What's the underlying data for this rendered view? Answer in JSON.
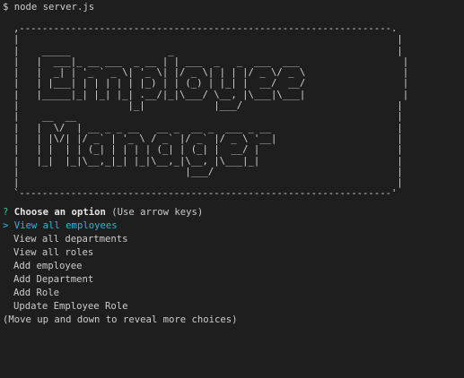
{
  "terminal": {
    "prompt_symbol": "$",
    "command": "node server.js"
  },
  "banner": {
    "ascii_art": ",-----------------------------------------------------------------.\n|                                                                  |\n|    _____                 _                                       |\n|   |  ___|_ __ ___  _ __ | | ___  _   _  ___  ___                  |\n|   |  _| | '_ ` _ \\| '_ \\| |/ _ \\| | | |/ _ \\/ _ \\                 |\n|   | |___| | | | | | |_) | | (_) | |_| |  __/  __/                 |\n|   |_____|_| |_| |_| .__/|_|\\___/ \\__, |\\___|\\___|                 |\n|                   |_|            |___/                           |\n|    __  __                                                        |\n|   |  \\/  | __ _ _ __   __ _  __ _  ___ _ __                      |\n|   | |\\/| |/ _` | '_ \\ / _` |/ _` |/ _ \\ '__|                     |\n|   | |  | | (_| | | | | (_| | (_| |  __/ |                        |\n|   |_|  |_|\\__,_|_| |_|\\__,_|\\__, |\\___|_|                        |\n|                             |___/                                |\n|                                                                  |\n`-----------------------------------------------------------------'"
  },
  "prompt": {
    "marker": "?",
    "question": "Choose an option",
    "hint": "(Use arrow keys)",
    "pointer": ">",
    "selected": "View all employees",
    "choices": [
      "View all departments",
      "View all roles",
      "Add employee",
      "Add Department",
      "Add Role",
      "Update Employee Role"
    ],
    "footer": "(Move up and down to reveal more choices)"
  },
  "colors": {
    "background": "#1e1e1e",
    "text": "#cccccc",
    "selected": "#29b8db",
    "question_marker": "#23d18b"
  }
}
